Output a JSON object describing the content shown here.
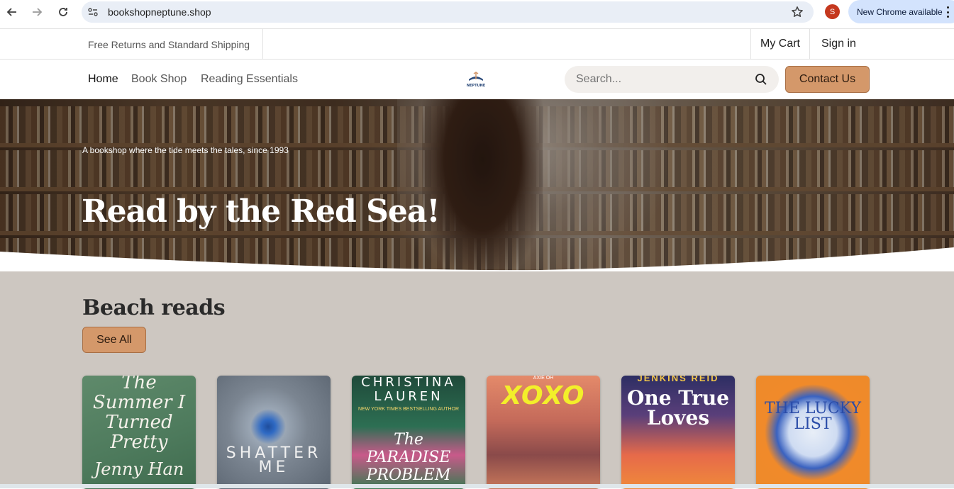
{
  "browser": {
    "url": "bookshopneptune.shop",
    "profile_initial": "S",
    "update_label": "New Chrome available"
  },
  "topbar": {
    "shipping": "Free Returns and Standard Shipping",
    "cart": "My Cart",
    "signin": "Sign in"
  },
  "nav": {
    "items": [
      {
        "label": "Home"
      },
      {
        "label": "Book Shop"
      },
      {
        "label": "Reading Essentials"
      }
    ],
    "logo_text": "NEPTUNE",
    "search_placeholder": "Search...",
    "contact": "Contact Us"
  },
  "hero": {
    "tagline": "A bookshop where the tide meets the tales, since 1993",
    "title": "Read by the Red Sea!"
  },
  "section": {
    "title": "Beach reads",
    "see_all": "See All",
    "books": [
      {
        "title": "The Summer I Turned Pretty",
        "author": "Jenny Han"
      },
      {
        "title": "SHATTER ME"
      },
      {
        "title": "The PARADISE PROBLEM",
        "author": "CHRISTINA LAUREN",
        "tag": "NEW YORK TIMES BESTSELLING AUTHOR"
      },
      {
        "title": "XOXO",
        "author": "AXIE OH"
      },
      {
        "title": "One True Loves",
        "author": "JENKINS REID"
      },
      {
        "title": "THE LUCKY LIST"
      }
    ]
  }
}
